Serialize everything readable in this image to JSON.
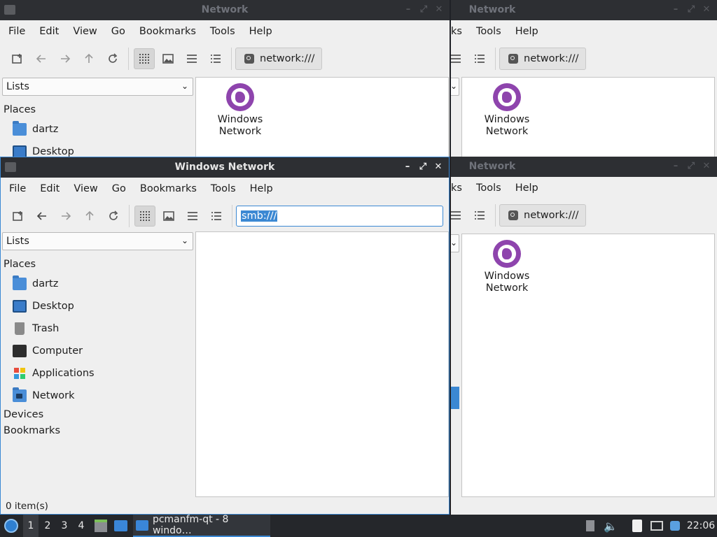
{
  "menu": [
    "File",
    "Edit",
    "View",
    "Go",
    "Bookmarks",
    "Tools",
    "Help"
  ],
  "menu_partial": [
    "ks",
    "Tools",
    "Help"
  ],
  "background_window_title": "Network",
  "active_window": {
    "title": "Windows Network",
    "location_value": "smb:///",
    "view_combo": "Lists",
    "sidebar": {
      "places_label": "Places",
      "items": [
        {
          "label": "dartz",
          "icon": "home-folder-icon"
        },
        {
          "label": "Desktop",
          "icon": "desktop-icon"
        },
        {
          "label": "Trash",
          "icon": "trash-icon"
        },
        {
          "label": "Computer",
          "icon": "computer-icon"
        },
        {
          "label": "Applications",
          "icon": "applications-icon"
        },
        {
          "label": "Network",
          "icon": "network-folder-icon"
        }
      ],
      "devices_label": "Devices",
      "bookmarks_label": "Bookmarks"
    },
    "status": "0 item(s)"
  },
  "top_left_window": {
    "title": "Network",
    "location": "network:///",
    "view_combo": "Lists",
    "places_label": "Places",
    "sidebar_items": [
      "dartz",
      "Desktop"
    ],
    "file_item": [
      "Windows",
      "Network"
    ]
  },
  "right_windows": {
    "location": "network:///",
    "file_item": [
      "Windows",
      "Network"
    ]
  },
  "taskbar": {
    "workspaces": [
      "1",
      "2",
      "3",
      "4"
    ],
    "active_workspace": "1",
    "task_label": "pcmanfm-qt - 8 windo…",
    "clock": "22:06"
  },
  "colors": {
    "accent": "#3b88d3",
    "network_icon": "#8e44ad",
    "titlebar": "#2d2f33",
    "taskbar": "#25272b"
  }
}
